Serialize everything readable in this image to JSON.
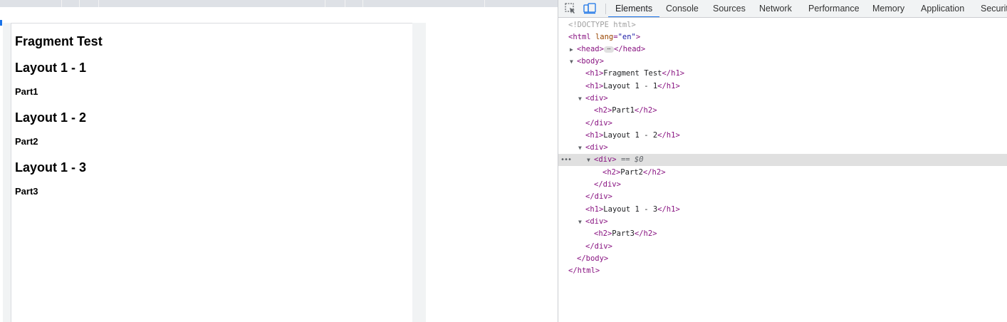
{
  "viewport": {
    "headings": {
      "h1_0": "Fragment Test",
      "h1_1": "Layout 1 - 1",
      "h2_1": "Part1",
      "h1_2": "Layout 1 - 2",
      "h2_2": "Part2",
      "h1_3": "Layout 1 - 3",
      "h2_3": "Part3"
    }
  },
  "devtools": {
    "icons": [
      "select-element-icon",
      "device-toolbar-icon"
    ],
    "tabs": {
      "elements": "Elements",
      "console": "Console",
      "sources": "Sources",
      "network": "Network",
      "performance": "Performance",
      "memory": "Memory",
      "application": "Application",
      "security": "Security"
    },
    "active_tab": "Elements",
    "dom": {
      "doctype": "<!DOCTYPE html>",
      "html_open_tag": "<html",
      "html_attr_name": "lang",
      "html_attr_eq": "=",
      "html_attr_value": "\"en\"",
      "html_open_close": ">",
      "head_open": "<head>",
      "head_ellipsis": "⋯",
      "head_close": "</head>",
      "body_open": "<body>",
      "h1_open": "<h1>",
      "h1_close": "</h1>",
      "h2_open": "<h2>",
      "h2_close": "</h2>",
      "div_open": "<div>",
      "div_close": "</div>",
      "body_close": "</body>",
      "html_close": "</html>",
      "fragment_test": "Fragment Test",
      "layout_1_1": "Layout 1 - 1",
      "part1": "Part1",
      "layout_1_2": "Layout 1 - 2",
      "part2": "Part2",
      "layout_1_3": "Layout 1 - 3",
      "part3": "Part3",
      "selected_marker": "== $0",
      "row_dots": "•••"
    },
    "colors": {
      "tag": "#881280",
      "attr_name": "#994500",
      "attr_value": "#1a1aa6",
      "active_tab_underline": "#1a73e8",
      "selected_row": "#e0e0e0"
    }
  }
}
